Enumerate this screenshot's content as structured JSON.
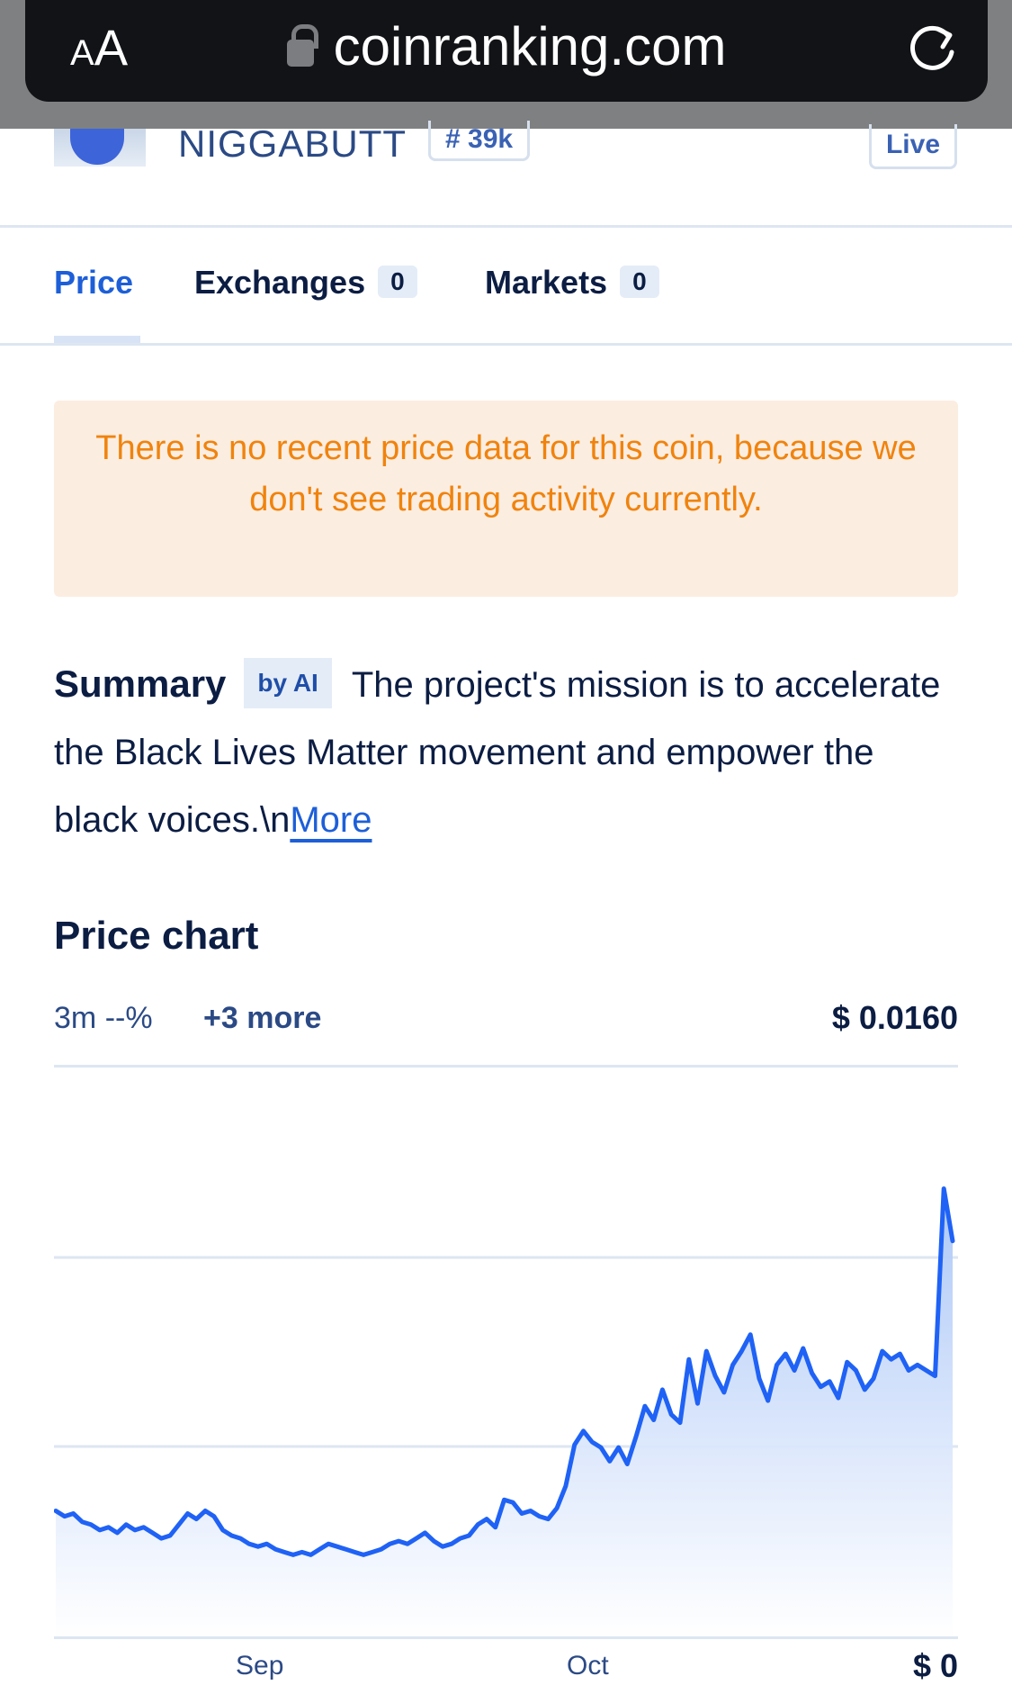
{
  "browser": {
    "aa_label_small": "A",
    "aa_label_large": "A",
    "url": "coinranking.com",
    "lock_icon": "lock-icon",
    "reload_icon": "reload-icon"
  },
  "coin": {
    "name": "NIGGABUTT",
    "rank": "# 39k",
    "live": "Live"
  },
  "tabs": [
    {
      "label": "Price"
    },
    {
      "label": "Exchanges",
      "count": "0"
    },
    {
      "label": "Markets",
      "count": "0"
    }
  ],
  "warning": "There is no recent price data for this coin, because we don't see trading activity currently.",
  "summary": {
    "title": "Summary",
    "badge": "by AI",
    "text": "The project's mission is to accelerate the Black Lives Matter movement and empower the black voices.\\n",
    "more": "More"
  },
  "price_chart": {
    "title": "Price chart",
    "period": "3m",
    "change": "--%",
    "more_options": "+3 more",
    "current_price": "$ 0.0160",
    "y_axis_bottom": "$ 0"
  },
  "chart_data": {
    "type": "area",
    "title": "",
    "xlabel": "",
    "ylabel": "",
    "x_tick_labels": [
      "Sep",
      "Oct"
    ],
    "grid": true,
    "colors": {
      "line": "#1f62f5",
      "fill_top": "#a9c5f7",
      "fill_bottom": "#ffffff"
    },
    "series": [
      {
        "values": [
          0.0043,
          0.0041,
          0.0042,
          0.0039,
          0.0038,
          0.0036,
          0.0037,
          0.0035,
          0.0038,
          0.0036,
          0.0037,
          0.0035,
          0.0033,
          0.0034,
          0.0038,
          0.0042,
          0.004,
          0.0043,
          0.0041,
          0.0036,
          0.0034,
          0.0033,
          0.0031,
          0.003,
          0.0031,
          0.0029,
          0.0028,
          0.0027,
          0.0028,
          0.0027,
          0.0029,
          0.0031,
          0.003,
          0.0029,
          0.0028,
          0.0027,
          0.0028,
          0.0029,
          0.0031,
          0.0032,
          0.0031,
          0.0033,
          0.0035,
          0.0032,
          0.003,
          0.0031,
          0.0033,
          0.0034,
          0.0038,
          0.004,
          0.0037,
          0.0047,
          0.0046,
          0.0042,
          0.0043,
          0.0041,
          0.004,
          0.0044,
          0.0052,
          0.0067,
          0.0072,
          0.0068,
          0.0066,
          0.0061,
          0.0066,
          0.006,
          0.007,
          0.0081,
          0.0076,
          0.0087,
          0.0078,
          0.0075,
          0.0098,
          0.0082,
          0.0101,
          0.0092,
          0.0086,
          0.0096,
          0.0101,
          0.0107,
          0.0091,
          0.0083,
          0.0096,
          0.01,
          0.0094,
          0.0102,
          0.0093,
          0.0088,
          0.009,
          0.0084,
          0.0097,
          0.0094,
          0.0087,
          0.0091,
          0.0101,
          0.0098,
          0.01,
          0.0094,
          0.0096,
          0.0094,
          0.0092,
          0.016,
          0.0141
        ]
      }
    ],
    "ylim": [
      0,
      0.017
    ]
  }
}
